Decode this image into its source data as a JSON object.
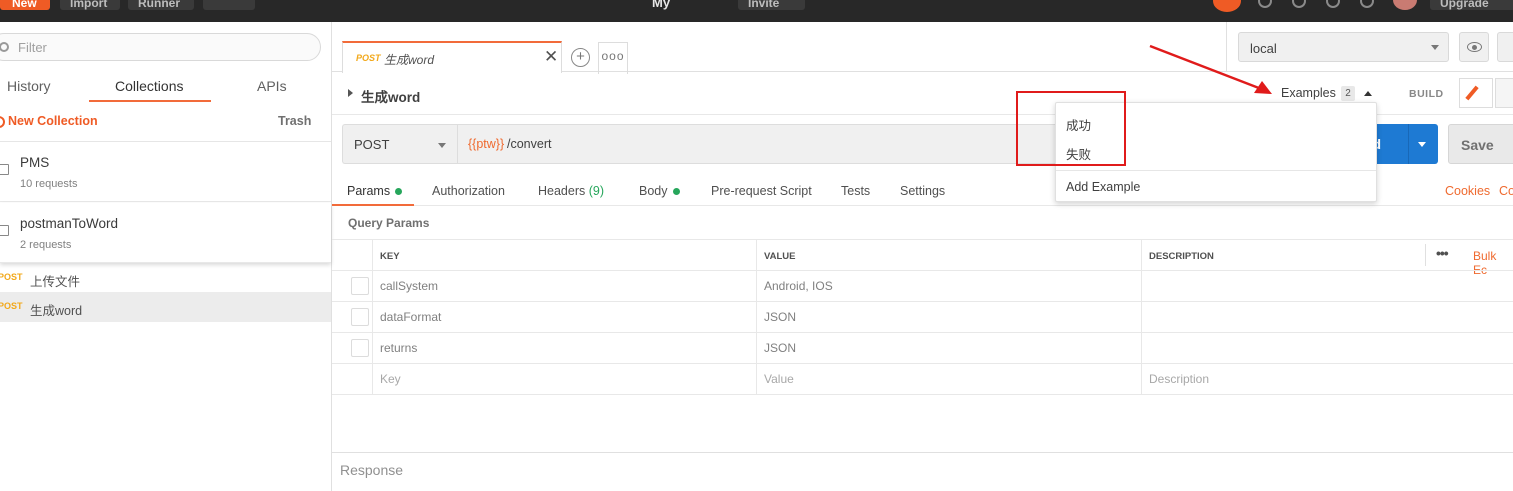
{
  "topbar": {
    "new_label": "New",
    "import_label": "Import",
    "runner_label": "Runner",
    "workspace_name": "My",
    "invite_label": "Invite",
    "upgrade_label": "Upgrade"
  },
  "sidebar": {
    "filter_placeholder": "Filter",
    "tabs": [
      "History",
      "Collections",
      "APIs"
    ],
    "active_tab": "Collections",
    "new_collection_label": "New Collection",
    "trash_label": "Trash",
    "collections": [
      {
        "name": "PMS",
        "count": "10 requests"
      },
      {
        "name": "postmanToWord",
        "count": "2 requests"
      }
    ],
    "requests": [
      {
        "method": "POST",
        "name": "上传文件"
      },
      {
        "method": "POST",
        "name": "生成word"
      }
    ]
  },
  "tab": {
    "method": "POST",
    "name": "生成word",
    "close": "✕",
    "add": "+",
    "more": "ooo"
  },
  "environment": {
    "selected": "local"
  },
  "request": {
    "title": "生成word",
    "method": "POST",
    "url_variable": "{{ptw}}",
    "url_path": "/convert",
    "send_label": "nd",
    "save_label": "Save"
  },
  "header_right": {
    "examples_label": "Examples",
    "examples_count": "2",
    "build_label": "BUILD"
  },
  "examples_menu": {
    "items": [
      "成功",
      "失败"
    ],
    "add_label": "Add Example"
  },
  "subtabs": {
    "params": "Params",
    "authorization": "Authorization",
    "headers": "Headers",
    "headers_count": "(9)",
    "body": "Body",
    "prerequest": "Pre-request Script",
    "tests": "Tests",
    "settings": "Settings",
    "cookies": "Cookies",
    "code": "Co"
  },
  "params": {
    "section_label": "Query Params",
    "columns": [
      "KEY",
      "VALUE",
      "DESCRIPTION"
    ],
    "more": "•••",
    "bulk_edit": "Bulk Ec",
    "rows": [
      {
        "key": "callSystem",
        "value": "Android, IOS",
        "description": ""
      },
      {
        "key": "dataFormat",
        "value": "JSON",
        "description": ""
      },
      {
        "key": "returns",
        "value": "JSON",
        "description": ""
      }
    ],
    "placeholder": {
      "key": "Key",
      "value": "Value",
      "description": "Description"
    }
  },
  "response": {
    "label": "Response"
  },
  "colors": {
    "accent": "#f26b3a",
    "send": "#1e7ad3",
    "annotation": "#e01b1b",
    "method_post": "#f2a81a"
  }
}
